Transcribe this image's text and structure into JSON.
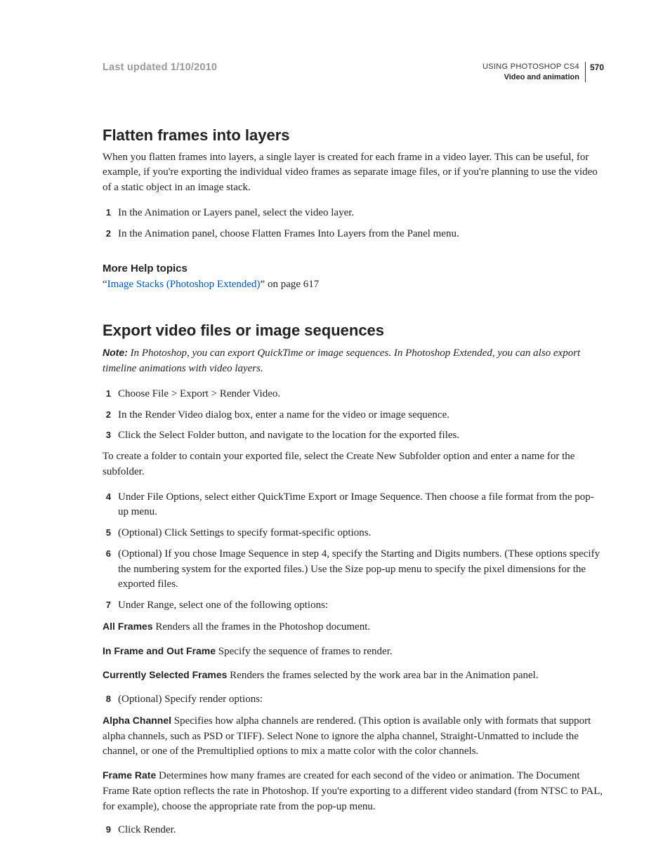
{
  "header": {
    "last_updated": "Last updated 1/10/2010",
    "doc_title": "USING PHOTOSHOP CS4",
    "section": "Video and animation",
    "page_number": "570"
  },
  "s1": {
    "heading": "Flatten frames into layers",
    "intro": "When you flatten frames into layers, a single layer is created for each frame in a video layer. This can be useful, for example, if you're exporting the individual video frames as separate image files, or if you're planning to use the video of a static object in an image stack.",
    "steps": {
      "n1": "1",
      "t1": "In the Animation or Layers panel, select the video layer.",
      "n2": "2",
      "t2": "In the Animation panel, choose Flatten Frames Into Layers from the Panel menu."
    },
    "more_help_label": "More Help topics",
    "link_open_quote": "“",
    "link_text": "Image Stacks (Photoshop Extended)",
    "link_tail": "” on page 617"
  },
  "s2": {
    "heading": "Export video files or image sequences",
    "note_label": "Note:",
    "note_text": " In Photoshop, you can export QuickTime or image sequences. In Photoshop Extended, you can also export timeline animations with video layers.",
    "steps_a": {
      "n1": "1",
      "t1": "Choose File > Export > Render Video.",
      "n2": "2",
      "t2": "In the Render Video dialog box, enter a name for the video or image sequence.",
      "n3": "3",
      "t3": "Click the Select Folder button, and navigate to the location for the exported files."
    },
    "para_subfolder": "To create a folder to contain your exported file, select the Create New Subfolder option and enter a name for the subfolder.",
    "steps_b": {
      "n4": "4",
      "t4": "Under File Options, select either QuickTime Export or Image Sequence. Then choose a file format from the pop-up menu.",
      "n5": "5",
      "t5": "(Optional) Click Settings to specify format-specific options.",
      "n6": "6",
      "t6": "(Optional) If you chose Image Sequence in step 4, specify the Starting and Digits numbers. (These options specify the numbering system for the exported files.) Use the Size pop-up menu to specify the pixel dimensions for the exported files.",
      "n7": "7",
      "t7": "Under Range, select one of the following options:"
    },
    "defs_a": {
      "term1": "All Frames",
      "desc1": "   Renders all the frames in the Photoshop document.",
      "term2": "In Frame and Out Frame",
      "desc2": "   Specify the sequence of frames to render.",
      "term3": "Currently Selected Frames",
      "desc3": "   Renders the frames selected by the work area bar in the Animation panel."
    },
    "steps_c": {
      "n8": "8",
      "t8": "(Optional) Specify render options:"
    },
    "defs_b": {
      "term1": "Alpha Channel",
      "desc1": "   Specifies how alpha channels are rendered. (This option is available only with formats that support alpha channels, such as PSD or TIFF). Select None to ignore the alpha channel, Straight-Unmatted to include the channel, or one of the Premultiplied options to mix a matte color with the color channels.",
      "term2": "Frame Rate",
      "desc2": "   Determines how many frames are created for each second of the video or animation. The Document Frame Rate option reflects the rate in Photoshop. If you're exporting to a different video standard (from NTSC to PAL, for example), choose the appropriate rate from the pop-up menu."
    },
    "steps_d": {
      "n9": "9",
      "t9": "Click Render."
    }
  }
}
